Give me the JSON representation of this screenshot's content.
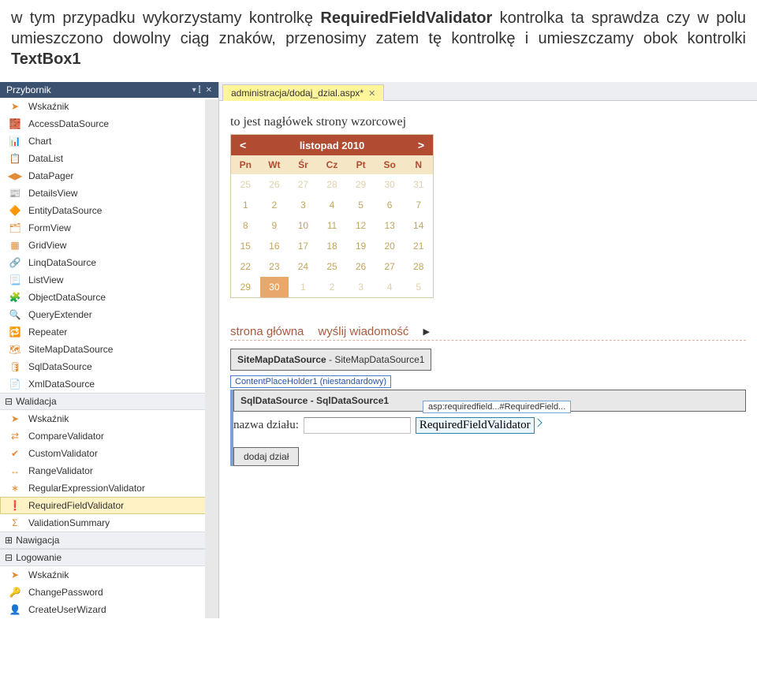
{
  "intro": {
    "prefix": "w tym przypadku wykorzystamy kontrolkę ",
    "bold1": "RequiredFieldValidator",
    "mid": " kontrolka ta sprawdza czy w polu umieszczono dowolny ciąg znaków, przenosimy zatem tę kontrolkę i umieszczamy obok kontrolki ",
    "bold2": "TextBox1"
  },
  "toolbox": {
    "title": "Przybornik",
    "items_top": [
      {
        "icon": "➤",
        "label": "Wskaźnik"
      },
      {
        "icon": "🧱",
        "label": "AccessDataSource"
      },
      {
        "icon": "📊",
        "label": "Chart"
      },
      {
        "icon": "📋",
        "label": "DataList"
      },
      {
        "icon": "◀▶",
        "label": "DataPager"
      },
      {
        "icon": "📰",
        "label": "DetailsView"
      },
      {
        "icon": "🔶",
        "label": "EntityDataSource"
      },
      {
        "icon": "🗂",
        "label": "FormView"
      },
      {
        "icon": "▦",
        "label": "GridView"
      },
      {
        "icon": "🔗",
        "label": "LinqDataSource"
      },
      {
        "icon": "📃",
        "label": "ListView"
      },
      {
        "icon": "🧩",
        "label": "ObjectDataSource"
      },
      {
        "icon": "🔍",
        "label": "QueryExtender"
      },
      {
        "icon": "🔁",
        "label": "Repeater"
      },
      {
        "icon": "🗺",
        "label": "SiteMapDataSource"
      },
      {
        "icon": "🛢",
        "label": "SqlDataSource"
      },
      {
        "icon": "📄",
        "label": "XmlDataSource"
      }
    ],
    "cat_validation": "Walidacja",
    "items_validation": [
      {
        "icon": "➤",
        "label": "Wskaźnik"
      },
      {
        "icon": "⇄",
        "label": "CompareValidator"
      },
      {
        "icon": "✔",
        "label": "CustomValidator"
      },
      {
        "icon": "↔",
        "label": "RangeValidator"
      },
      {
        "icon": "∗",
        "label": "RegularExpressionValidator"
      },
      {
        "icon": "❗",
        "label": "RequiredFieldValidator",
        "selected": true
      },
      {
        "icon": "Σ",
        "label": "ValidationSummary"
      }
    ],
    "cat_nav": "Nawigacja",
    "cat_login": "Logowanie",
    "items_login": [
      {
        "icon": "➤",
        "label": "Wskaźnik"
      },
      {
        "icon": "🔑",
        "label": "ChangePassword"
      },
      {
        "icon": "👤",
        "label": "CreateUserWizard"
      }
    ]
  },
  "tab": {
    "label": "administracja/dodaj_dzial.aspx*"
  },
  "master": {
    "header": "to jest nagłówek strony wzorcowej"
  },
  "calendar": {
    "month": "listopad 2010",
    "days": [
      "Pn",
      "Wt",
      "Śr",
      "Cz",
      "Pt",
      "So",
      "N"
    ],
    "rows": [
      {
        "cells": [
          {
            "v": "25",
            "o": true
          },
          {
            "v": "26",
            "o": true
          },
          {
            "v": "27",
            "o": true
          },
          {
            "v": "28",
            "o": true
          },
          {
            "v": "29",
            "o": true
          },
          {
            "v": "30",
            "o": true
          },
          {
            "v": "31",
            "o": true
          }
        ]
      },
      {
        "cells": [
          {
            "v": "1"
          },
          {
            "v": "2"
          },
          {
            "v": "3"
          },
          {
            "v": "4"
          },
          {
            "v": "5"
          },
          {
            "v": "6"
          },
          {
            "v": "7"
          }
        ]
      },
      {
        "cells": [
          {
            "v": "8"
          },
          {
            "v": "9"
          },
          {
            "v": "10"
          },
          {
            "v": "11"
          },
          {
            "v": "12"
          },
          {
            "v": "13"
          },
          {
            "v": "14"
          }
        ]
      },
      {
        "cells": [
          {
            "v": "15"
          },
          {
            "v": "16"
          },
          {
            "v": "17"
          },
          {
            "v": "18"
          },
          {
            "v": "19"
          },
          {
            "v": "20"
          },
          {
            "v": "21"
          }
        ]
      },
      {
        "cells": [
          {
            "v": "22"
          },
          {
            "v": "23"
          },
          {
            "v": "24"
          },
          {
            "v": "25"
          },
          {
            "v": "26"
          },
          {
            "v": "27"
          },
          {
            "v": "28"
          }
        ]
      },
      {
        "cells": [
          {
            "v": "29"
          },
          {
            "v": "30",
            "sel": true
          },
          {
            "v": "1",
            "o": true
          },
          {
            "v": "2",
            "o": true
          },
          {
            "v": "3",
            "o": true
          },
          {
            "v": "4",
            "o": true
          },
          {
            "v": "5",
            "o": true
          }
        ]
      }
    ]
  },
  "links": {
    "l1": "strona główna",
    "l2": "wyślij wiadomość"
  },
  "smds": {
    "strong": "SiteMapDataSource",
    "rest": " - SiteMapDataSource1"
  },
  "cph": {
    "tag": "ContentPlaceHolder1 (niestandardowy)"
  },
  "sqlds": {
    "strong": "SqlDataSource",
    "rest": " - SqlDataSource1"
  },
  "chip": "asp:requiredfield...#RequiredField...",
  "form": {
    "label": "nazwa działu:",
    "validator_text": "RequiredFieldValidator",
    "submit": "dodaj dział"
  }
}
